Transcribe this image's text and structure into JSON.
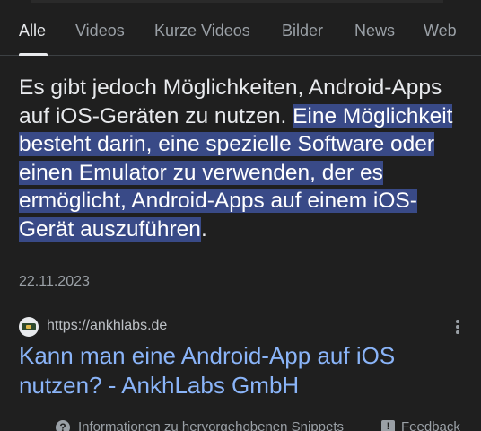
{
  "tabs": [
    {
      "label": "Alle",
      "active": true
    },
    {
      "label": "Videos",
      "active": false
    },
    {
      "label": "Kurze Videos",
      "active": false
    },
    {
      "label": "Bilder",
      "active": false
    },
    {
      "label": "News",
      "active": false
    },
    {
      "label": "Web",
      "active": false
    }
  ],
  "snippet": {
    "text_plain": "Es gibt jedoch Möglichkeiten, Android-Apps auf iOS-Geräten zu nutzen. ",
    "text_highlighted": "Eine Möglichkeit besteht darin, eine spezielle Software oder einen Emulator zu verwenden, der es ermöglicht, Android-Apps auf einem iOS-Gerät auszuführen",
    "text_end": ".",
    "date": "22.11.2023"
  },
  "result": {
    "favicon": "ankhlabs-logo-icon",
    "url": "https://ankhlabs.de",
    "title": "Kann man eine Android-App auf iOS nutzen? - AnkhLabs GmbH"
  },
  "footer": {
    "info_icon": "question-circle-icon",
    "info_label": "Informationen zu hervorgehobenen Snippets",
    "feedback_icon": "feedback-icon",
    "feedback_label": "Feedback"
  },
  "colors": {
    "background": "#1f1f1f",
    "highlight": "#394a87",
    "link": "#8ab4f8",
    "muted": "#9aa0a6"
  }
}
